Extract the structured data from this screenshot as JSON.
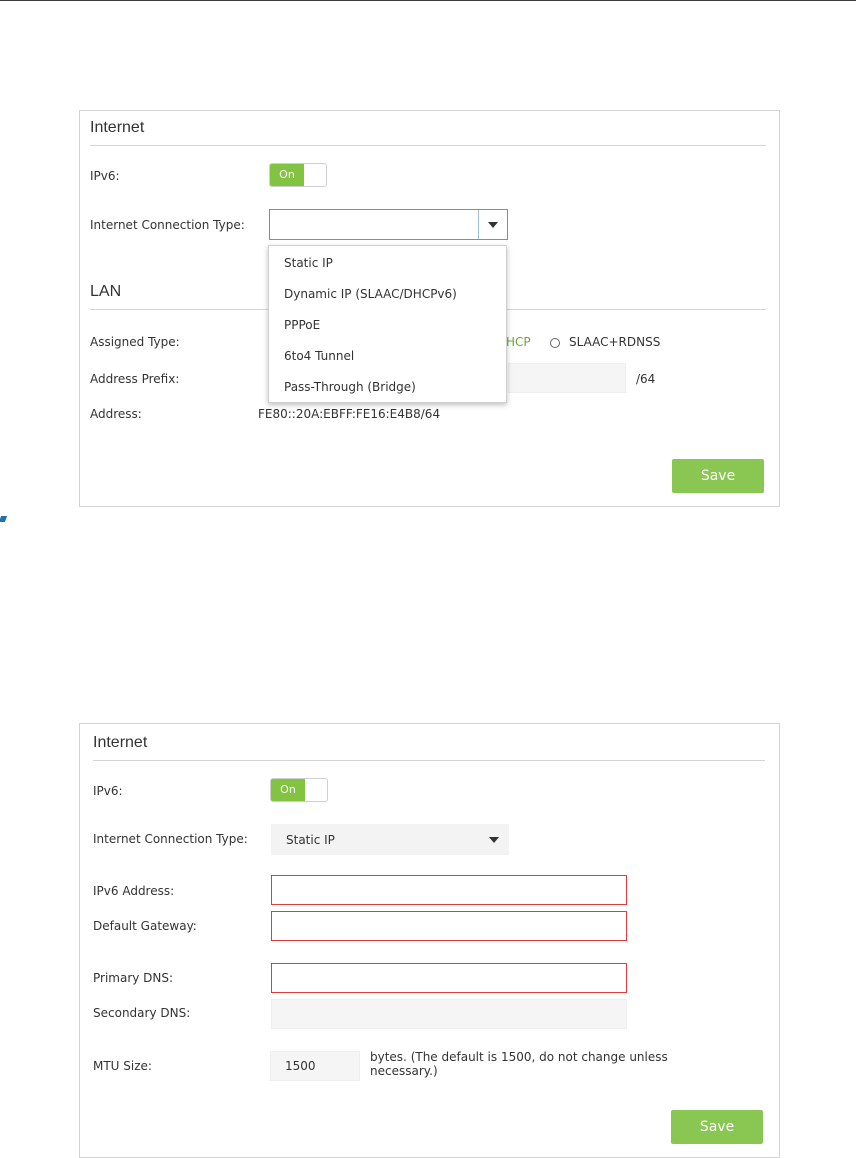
{
  "panel1": {
    "title": "Internet",
    "ipv6_label": "IPv6:",
    "ipv6_toggle": "On",
    "conn_type_label": "Internet Connection Type:",
    "conn_type_value": "",
    "dropdown_options": [
      "Static IP",
      "Dynamic IP (SLAAC/DHCPv6)",
      "PPPoE",
      "6to4 Tunnel",
      "Pass-Through (Bridge)"
    ],
    "lan_title": "LAN",
    "assigned_type_label": "Assigned Type:",
    "assigned_partial": "HCP",
    "assigned_option": "SLAAC+RDNSS",
    "address_prefix_label": "Address Prefix:",
    "prefix_suffix": "/64",
    "address_label": "Address:",
    "address_value": "FE80::20A:EBFF:FE16:E4B8/64",
    "save": "Save"
  },
  "panel2": {
    "title": "Internet",
    "ipv6_label": "IPv6:",
    "ipv6_toggle": "On",
    "conn_type_label": "Internet Connection Type:",
    "conn_type_value": "Static IP",
    "ipv6_address_label": "IPv6 Address:",
    "default_gateway_label": "Default Gateway:",
    "primary_dns_label": "Primary DNS:",
    "secondary_dns_label": "Secondary DNS:",
    "mtu_label": "MTU Size:",
    "mtu_value": "1500",
    "mtu_hint": "bytes. (The default is 1500, do not change unless necessary.)",
    "save": "Save"
  },
  "colors": {
    "accent_green": "#82c341",
    "error_red": "#e23b3b",
    "focus_blue": "#4a9fd8"
  }
}
